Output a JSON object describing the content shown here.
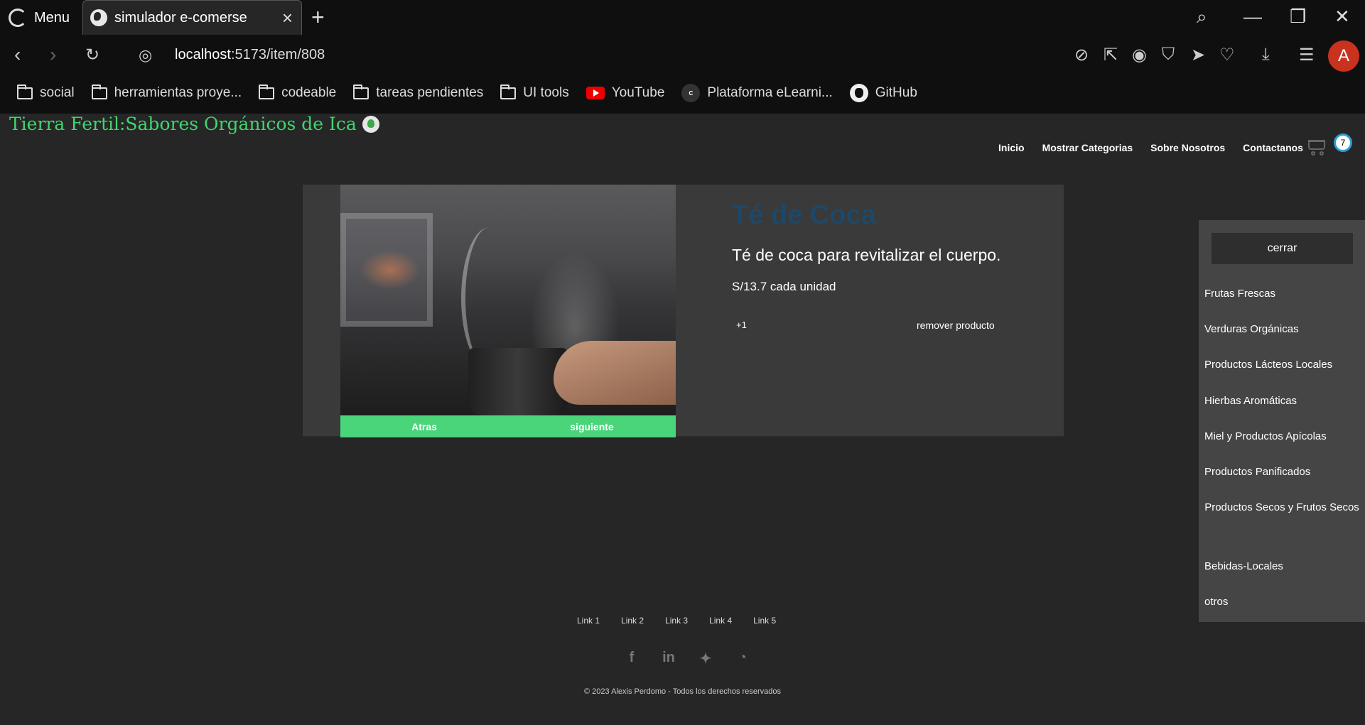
{
  "browser": {
    "menu_label": "Menu",
    "tab_title": "simulador e-comerse",
    "url_host": "localhost",
    "url_path": ":5173/item/808",
    "avatar_letter": "A",
    "bookmarks": [
      {
        "label": "social",
        "icon": "folder-icon"
      },
      {
        "label": "herramientas proye...",
        "icon": "folder-icon"
      },
      {
        "label": "codeable",
        "icon": "folder-icon"
      },
      {
        "label": "tareas pendientes",
        "icon": "folder-icon"
      },
      {
        "label": "UI tools",
        "icon": "folder-icon"
      },
      {
        "label": "YouTube",
        "icon": "youtube-icon"
      },
      {
        "label": "Plataforma eLearni...",
        "icon": "coder-icon"
      },
      {
        "label": "GitHub",
        "icon": "github-icon"
      }
    ]
  },
  "site": {
    "brand": "Tierra Fertil:Sabores Orgánicos de Ica",
    "nav": [
      "Inicio",
      "Mostrar Categorias",
      "Sobre Nosotros",
      "Contactanos"
    ],
    "cart_count": "7"
  },
  "product": {
    "title": "Té de Coca",
    "description": "Té de coca para revitalizar el cuerpo.",
    "price": "S/13.7 cada unidad",
    "add_label": "+1",
    "remove_label": "remover producto",
    "carousel_prev": "Atras",
    "carousel_next": "siguiente"
  },
  "sidebar": {
    "close_label": "cerrar",
    "categories": [
      "Frutas Frescas",
      "Verduras Orgánicas",
      "Productos Lácteos Locales",
      "Hierbas Aromáticas",
      "Miel y Productos Apícolas",
      "Productos Panificados",
      "Productos Secos y Frutos Secos",
      "Bebidas-Locales",
      "otros"
    ]
  },
  "footer": {
    "links": [
      "Link 1",
      "Link 2",
      "Link 3",
      "Link 4",
      "Link 5"
    ],
    "social": [
      "facebook-icon",
      "linkedin-icon",
      "twitter-icon",
      "github-icon"
    ],
    "copyright": "© 2023 Alexis Perdomo - Todos los derechos reservados"
  },
  "colors": {
    "brand": "#3fd66e",
    "carousel_bar": "#4ad57a",
    "title": "#1d4868",
    "badge_border": "#2b9cd8"
  }
}
